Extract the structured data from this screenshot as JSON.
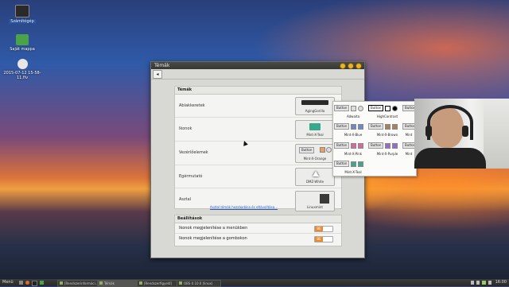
{
  "desktop": {
    "icons": [
      {
        "label": "Számítógép",
        "color": "#2a2a2a"
      },
      {
        "label": "Saját mappa",
        "color": "#4aa24a"
      },
      {
        "label": "2015-07-12 15-58-11.flv",
        "color": "#e6e6e6"
      }
    ]
  },
  "window": {
    "title": "Témák",
    "back_icon": "◂",
    "themes_section": {
      "header": "Témák",
      "rows": [
        {
          "label": "Ablakkeretek",
          "value": "AgingGorilla"
        },
        {
          "label": "Ikonok",
          "value": "Mint-X-Teal"
        },
        {
          "label": "Vezérlőelemek",
          "value": "Mint-X-Orange"
        },
        {
          "label": "Egérmutató",
          "value": "DMZ-White"
        },
        {
          "label": "Asztal",
          "value": "Linuxmint"
        }
      ],
      "desktop_link": "Asztal témák hozzáadása és eltávolítása..."
    },
    "settings_section": {
      "header": "Beállítások",
      "rows": [
        {
          "label": "Ikonok megjelenítése a menükben",
          "toggle": "BE"
        },
        {
          "label": "Ikonok megjelenítése a gombokon",
          "toggle": "BE"
        }
      ]
    },
    "preview_button_label": "Button"
  },
  "popup": {
    "button_label": "Button",
    "items": [
      {
        "name": "Adwaita"
      },
      {
        "name": "HighContrast"
      },
      {
        "name": "Mint-X-Blue"
      },
      {
        "name": "Mint-X-Brown"
      },
      {
        "name": "Mint-X-Pink"
      },
      {
        "name": "Mint-X-Purple"
      },
      {
        "name": "Mint-X-Teal"
      }
    ],
    "partial_right": [
      "Mint",
      "Mint",
      "Mint"
    ]
  },
  "taskbar": {
    "menu_label": "Menü",
    "tasks": [
      {
        "label": "[Rendszerinformáci...",
        "active": false
      },
      {
        "label": "Témák",
        "active": true
      },
      {
        "label": "[Rendszerfigyelő]",
        "active": false
      },
      {
        "label": "OBS 0.10.0 (linux)",
        "active": false
      }
    ],
    "clock": "16:00"
  },
  "colors": {
    "accent": "#e88a30",
    "link": "#2a5ab8",
    "titlebar_button": "#e8b428"
  }
}
